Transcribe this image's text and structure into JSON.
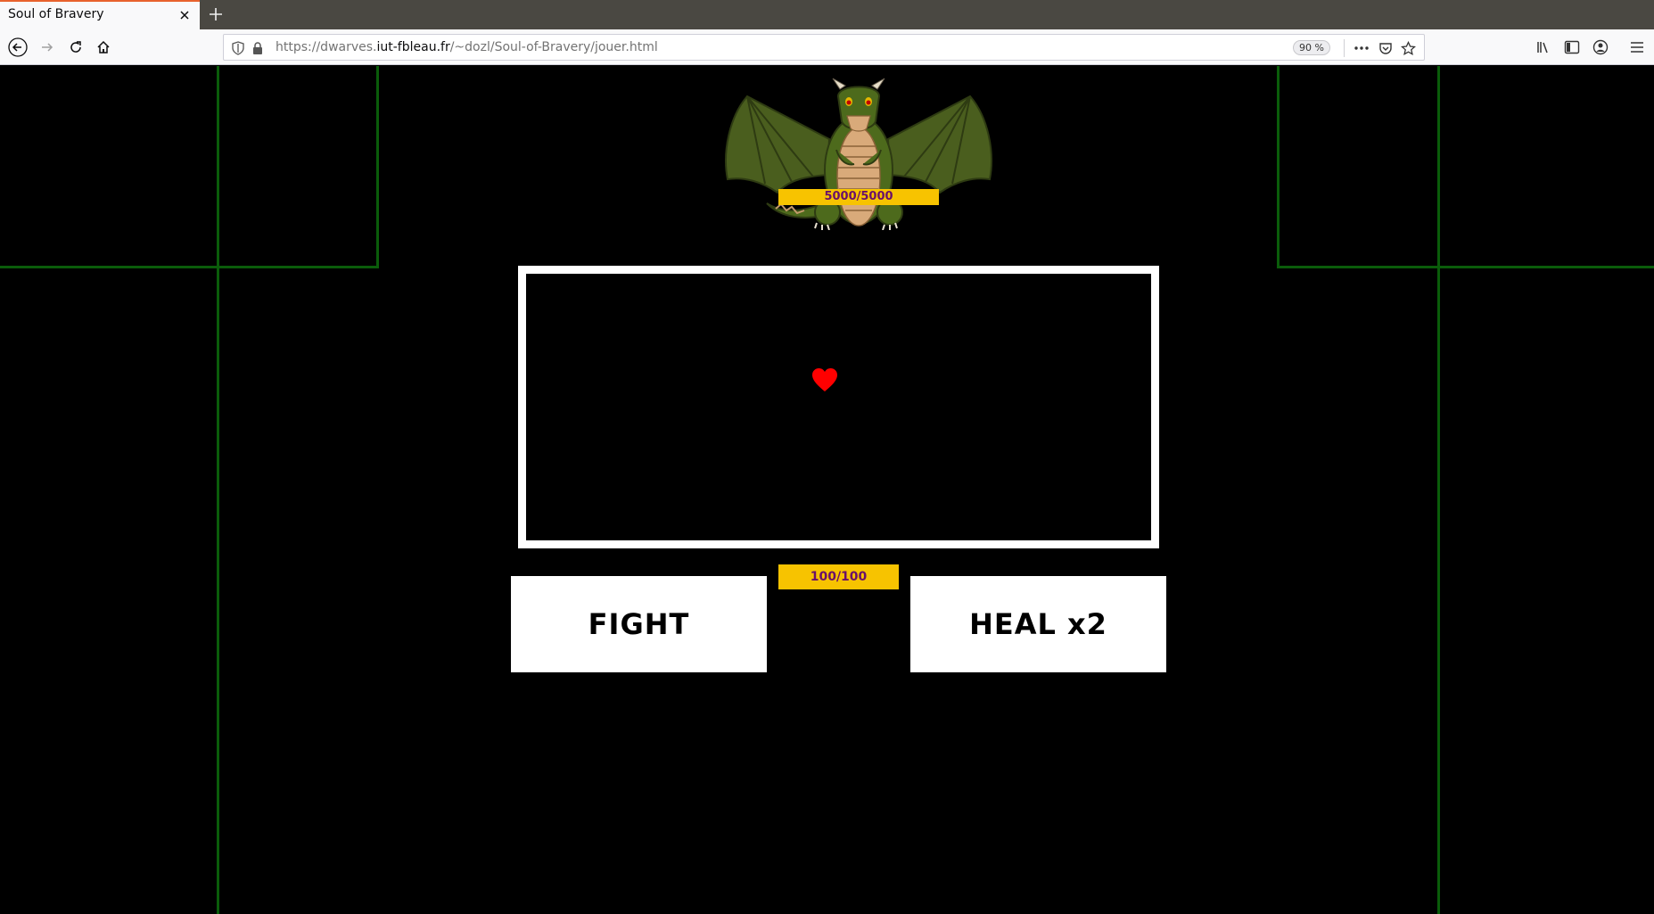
{
  "browser": {
    "tab_title": "Soul of Bravery",
    "url": {
      "scheme_prefix": "https://dwarves.",
      "host": "iut-fbleau.fr",
      "path": "/~dozl/Soul-of-Bravery/jouer.html"
    },
    "zoom": "90 %"
  },
  "game": {
    "boss": {
      "hp_text": "5000/5000",
      "hp_current": 5000,
      "hp_max": 5000
    },
    "player": {
      "hp_text": "100/100",
      "hp_current": 100,
      "hp_max": 100
    },
    "actions": {
      "fight_label": "FIGHT",
      "heal_label": "HEAL x2"
    }
  },
  "colors": {
    "background": "#000000",
    "grid_lines": "#0a5c0a",
    "hp_bar": "#f7c300",
    "hp_text": "#6a0f6a",
    "soul": "#ff0000",
    "tab_accent": "#e8622d"
  }
}
